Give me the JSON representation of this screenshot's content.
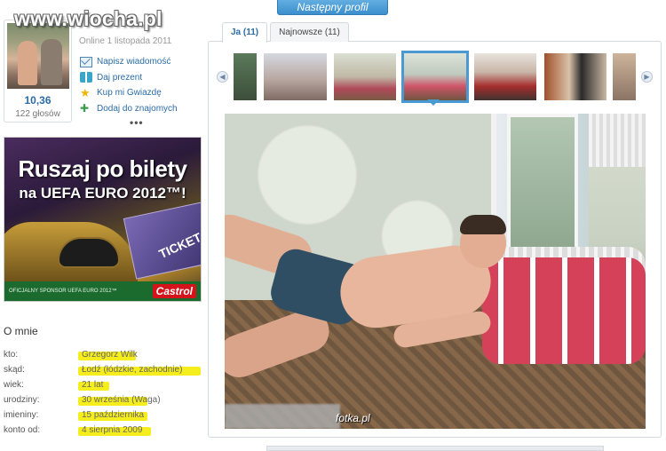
{
  "watermark": "www.wiocha.pl",
  "next_profile_label": "Następny profil",
  "profile": {
    "rating": "10,36",
    "votes": "122 głosów",
    "online": "Online 1 listopada 2011",
    "more": "•••"
  },
  "actions": [
    {
      "label": "Napisz wiadomość",
      "icon": "mail-icon"
    },
    {
      "label": "Daj prezent",
      "icon": "gift-icon"
    },
    {
      "label": "Kup mi Gwiazdę",
      "icon": "star-icon"
    },
    {
      "label": "Dodaj do znajomych",
      "icon": "add-friend-icon"
    }
  ],
  "ad": {
    "headline": "Ruszaj po bilety",
    "subline": "na UEFA EURO 2012™!",
    "ticket": "TICKET",
    "footer": "OFICJALNY SPONSOR UEFA EURO 2012™",
    "brand": "Castrol"
  },
  "about": {
    "title": "O mnie",
    "rows": [
      {
        "key": "kto:",
        "value": "Grzegorz Wilk"
      },
      {
        "key": "skąd:",
        "value": "Łodź (łódzkie, zachodnie)"
      },
      {
        "key": "wiek:",
        "value": "21 lat"
      },
      {
        "key": "urodziny:",
        "value": "30 września (Waga)"
      },
      {
        "key": "imieniny:",
        "value": "15 października"
      },
      {
        "key": "konto od:",
        "value": "4 sierpnia 2009"
      }
    ]
  },
  "tabs": [
    {
      "label": "Ja (11)",
      "active": true
    },
    {
      "label": "Najnowsze (11)",
      "active": false
    }
  ],
  "photo": {
    "watermark": "fotka.pl"
  },
  "colors": {
    "link": "#2b6ca6",
    "accent": "#4a9ad1",
    "highlight": "#f6ec10"
  }
}
